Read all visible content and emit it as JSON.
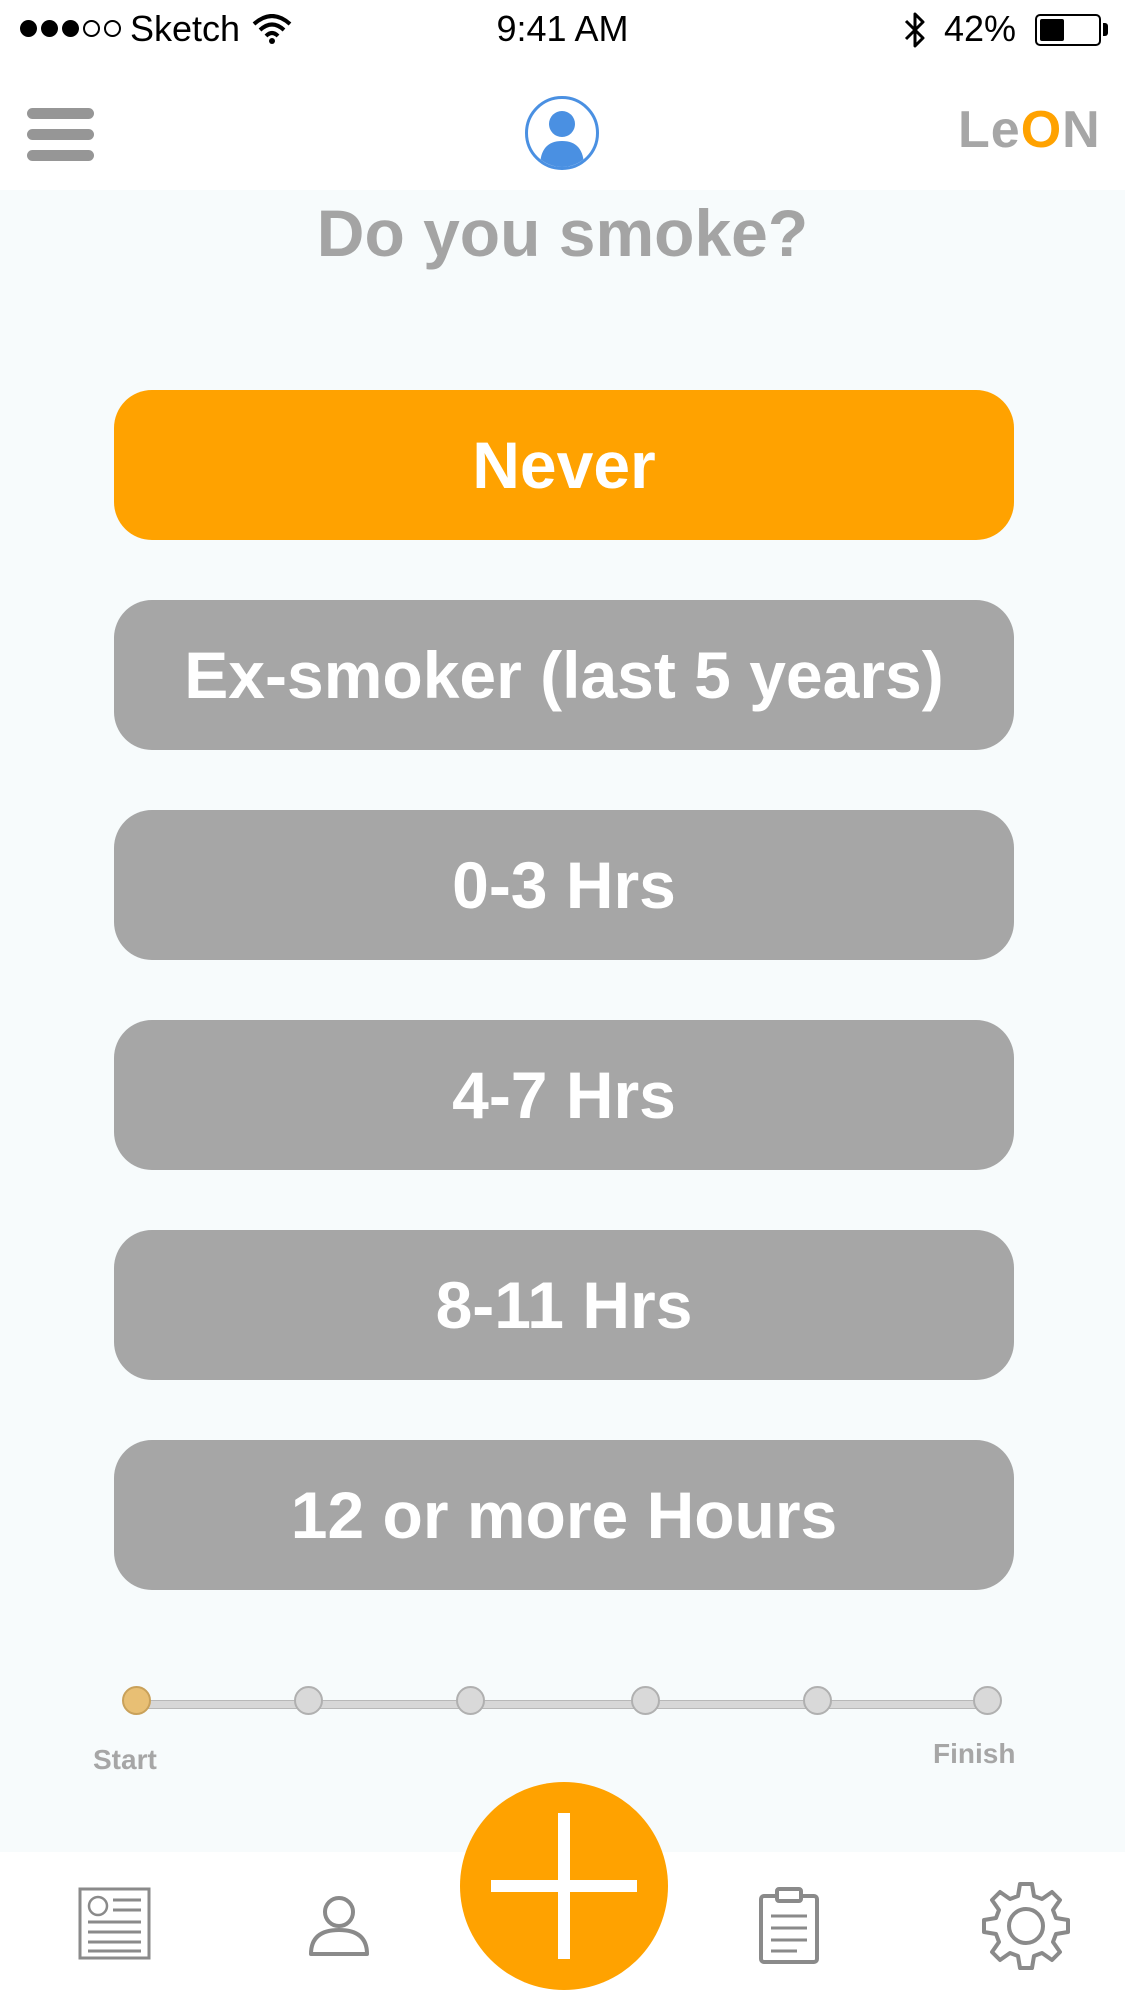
{
  "status_bar": {
    "carrier": "Sketch",
    "time": "9:41 AM",
    "battery": "42%",
    "battery_level": 0.42
  },
  "nav": {
    "logo_prefix": "Le",
    "logo_accent": "O",
    "logo_suffix": "N"
  },
  "title": "Do you smoke?",
  "options": [
    {
      "label": "Never",
      "selected": true
    },
    {
      "label": "Ex-smoker (last 5 years)",
      "selected": false
    },
    {
      "label": "0-3 Hrs",
      "selected": false
    },
    {
      "label": "4-7 Hrs",
      "selected": false
    },
    {
      "label": "8-11 Hrs",
      "selected": false
    },
    {
      "label": "12 or more Hours",
      "selected": false
    }
  ],
  "progress": {
    "start_label": "Start",
    "finish_label": "Finish",
    "total_steps": 6,
    "current_step": 1
  },
  "tab_bar": {
    "items": [
      "news-icon",
      "profile-icon",
      "add-icon",
      "clipboard-icon",
      "gear-icon"
    ]
  },
  "colors": {
    "accent": "#ffa200",
    "inactive": "#a6a6a6",
    "avatar": "#4a90e2"
  }
}
